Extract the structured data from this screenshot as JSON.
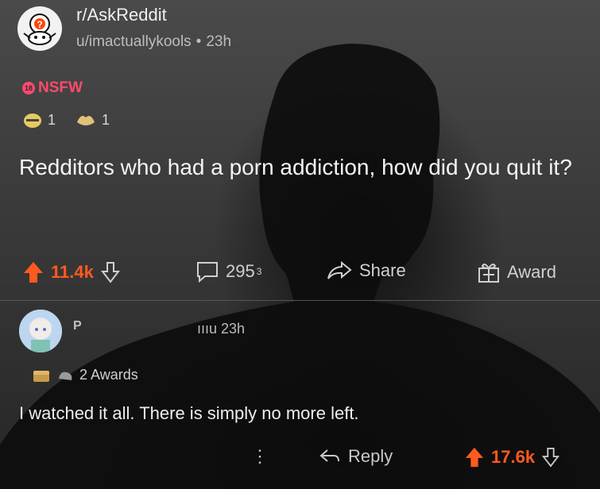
{
  "post": {
    "subreddit": "r/AskReddit",
    "author": "u/imactuallykools",
    "separator": "•",
    "age": "23h",
    "nsfw_label": "NSFW",
    "nsfw_badge": "18",
    "awards": [
      {
        "icon": "award-face-icon",
        "count": "1"
      },
      {
        "icon": "award-hands-icon",
        "count": "1"
      }
    ],
    "title": "Redditors who had a porn addiction, how did you quit it?",
    "upvotes": "11.4k",
    "comments": "295",
    "comments_glitch": "3",
    "share_label": "Share",
    "award_label": "Award"
  },
  "comment": {
    "user": "P",
    "user_suffix": "ıııu",
    "age": "23h",
    "awards_label": "2 Awards",
    "body": "I watched it all. There is simply no more left.",
    "more_icon": "⋮",
    "reply_label": "Reply",
    "upvotes": "17.6k"
  },
  "colors": {
    "upvote": "#ff5a1f",
    "nsfw": "#ff4a6b",
    "text": "#f4f4f4"
  }
}
